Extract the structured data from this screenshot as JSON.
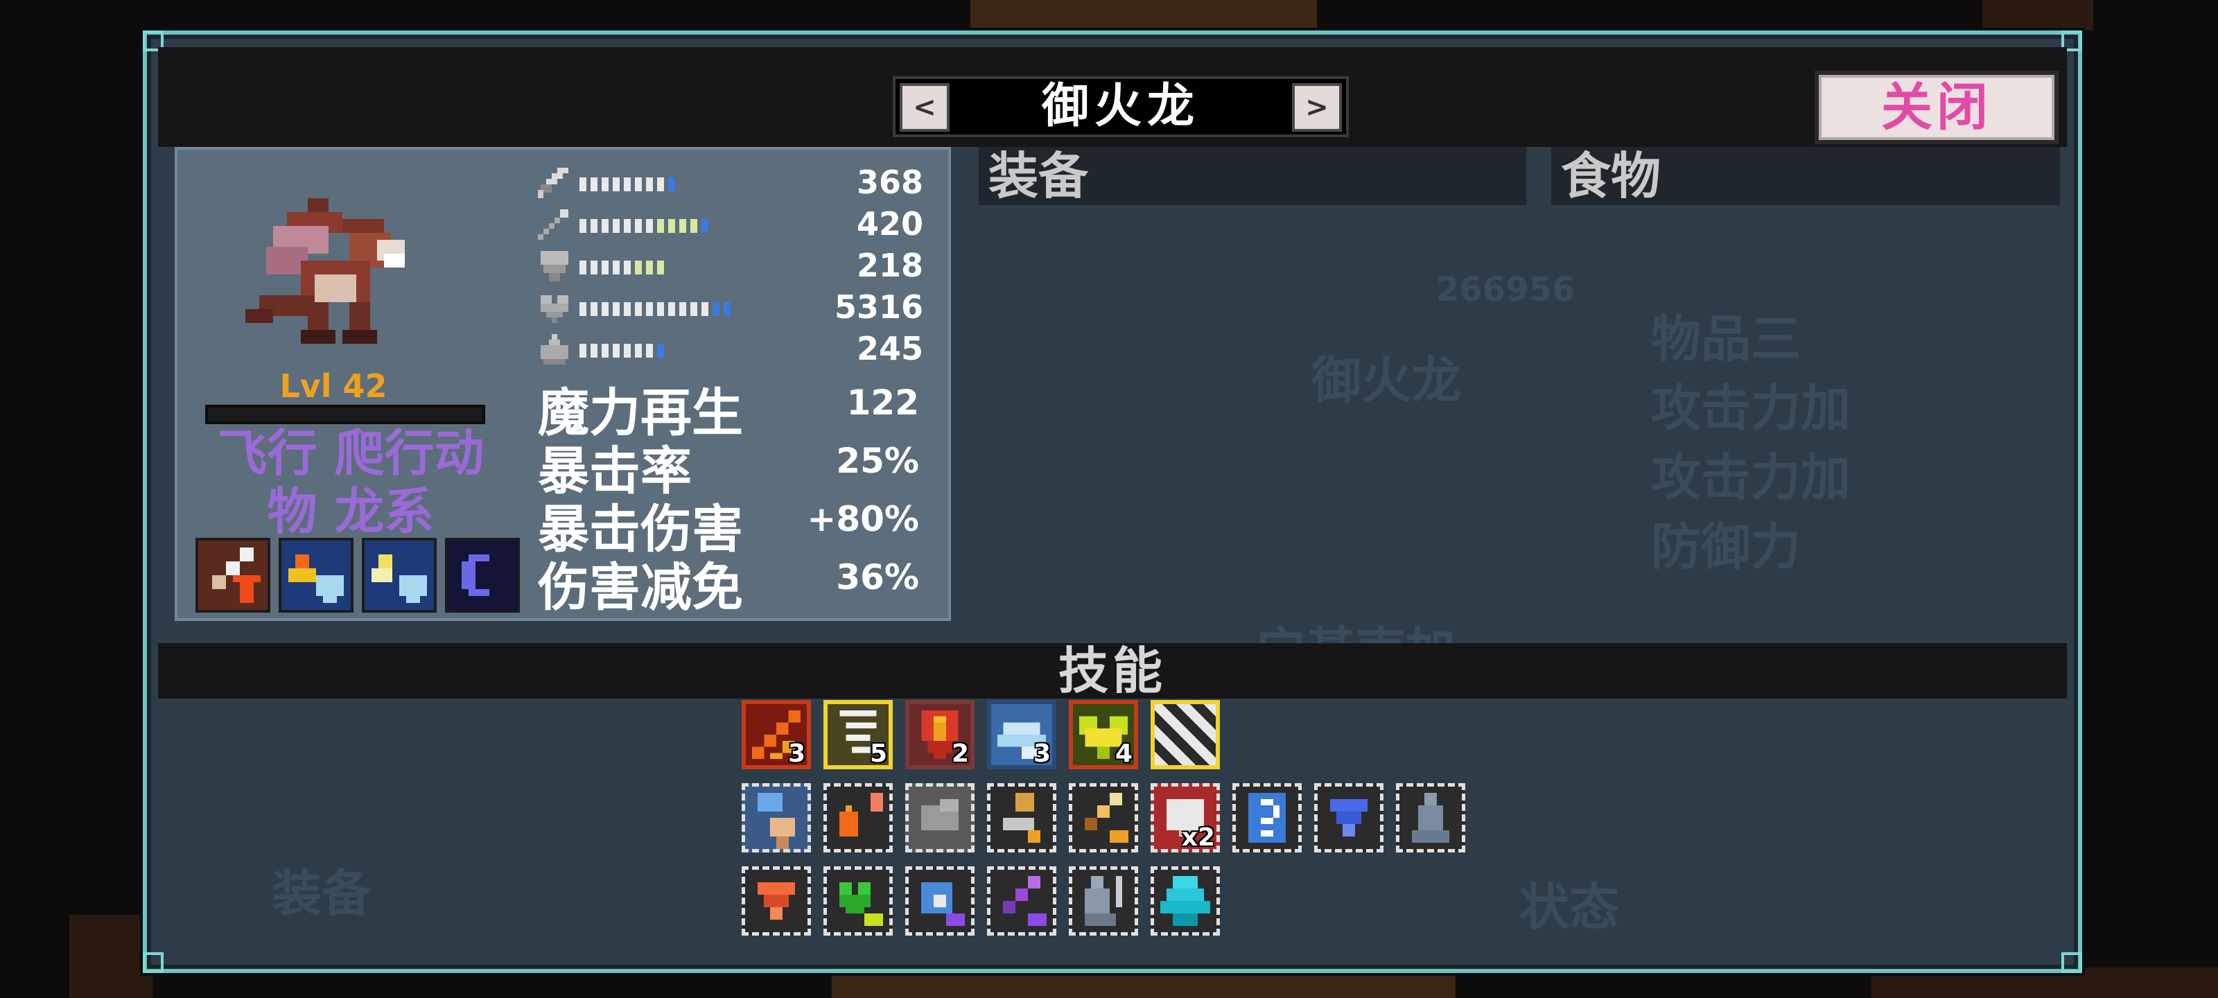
{
  "header": {
    "title": "御火龙",
    "prev_label": "<",
    "next_label": ">",
    "close_label": "关闭"
  },
  "pet": {
    "level_label": "Lvl 42",
    "types_line1": "飞行 爬行动",
    "types_line2": "物 龙系",
    "stats": [
      {
        "icon": "sword-icon",
        "value": "368",
        "filled_segments": 7
      },
      {
        "icon": "wand-icon",
        "value": "420",
        "filled_segments": 9
      },
      {
        "icon": "shield-icon",
        "value": "218",
        "filled_segments": 5
      },
      {
        "icon": "heart-icon",
        "value": "5316",
        "filled_segments": 10
      },
      {
        "icon": "flask-icon",
        "value": "245",
        "filled_segments": 5
      }
    ],
    "attributes": [
      {
        "label": "魔力再生",
        "value": "122"
      },
      {
        "label": "暴击率",
        "value": "25%"
      },
      {
        "label": "暴击伤害",
        "value": "+80%"
      },
      {
        "label": "伤害减免",
        "value": "36%"
      }
    ]
  },
  "sections": {
    "equipment": "装备",
    "food": "食物",
    "skills": "技能"
  },
  "skills": {
    "row1_counts": [
      "3",
      "5",
      "2",
      "3",
      "4",
      ""
    ],
    "row2_counts": [
      "",
      "",
      "",
      "",
      "",
      "2",
      "",
      "",
      ""
    ],
    "row2_extra": "x"
  },
  "colors": {
    "panel_border": "#6fc4c0",
    "stat_bar_white": "#e9e9e9",
    "stat_bar_blue": "#3b7be0",
    "stat_bar_yellow": "#d8e8a0",
    "type_text": "#9a6ad8",
    "level_text": "#f0a020",
    "close_text": "#e34aa7"
  }
}
